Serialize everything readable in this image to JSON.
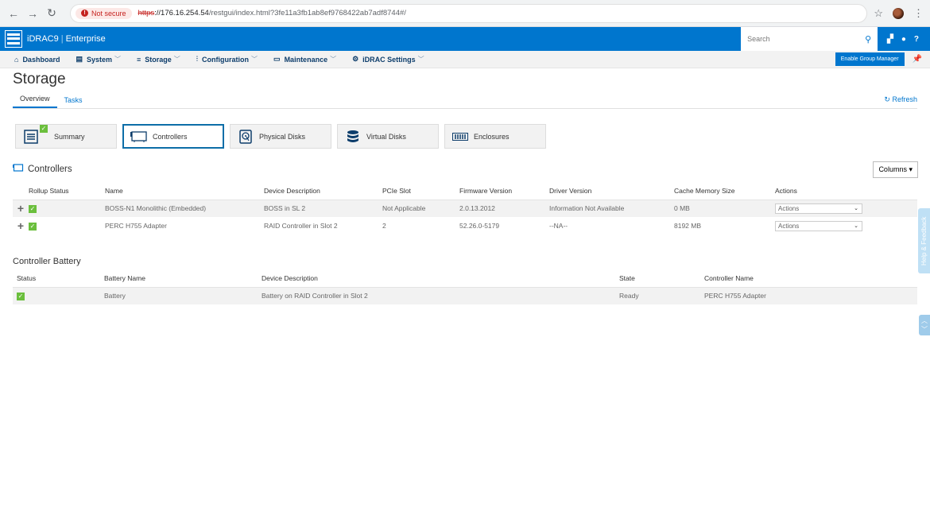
{
  "browser": {
    "security_label": "Not secure",
    "url_scheme": "https",
    "url_host": "://176.16.254.54",
    "url_path": "/restgui/index.html?3fe11a3fb1ab8ef9768422ab7adf8744#/"
  },
  "header": {
    "product": "iDRAC9",
    "edition": "Enterprise",
    "search_placeholder": "Search"
  },
  "nav": {
    "items": [
      {
        "label": "Dashboard",
        "icon": "home-icon",
        "dropdown": false
      },
      {
        "label": "System",
        "icon": "server-icon",
        "dropdown": true
      },
      {
        "label": "Storage",
        "icon": "database-icon",
        "dropdown": true
      },
      {
        "label": "Configuration",
        "icon": "sliders-icon",
        "dropdown": true
      },
      {
        "label": "Maintenance",
        "icon": "monitor-icon",
        "dropdown": true
      },
      {
        "label": "iDRAC Settings",
        "icon": "gears-icon",
        "dropdown": true
      }
    ],
    "group_manager_label": "Enable Group Manager"
  },
  "page": {
    "title": "Storage",
    "tabs": [
      "Overview",
      "Tasks"
    ],
    "refresh_label": "Refresh"
  },
  "tiles": [
    {
      "label": "Summary",
      "active": false
    },
    {
      "label": "Controllers",
      "active": true
    },
    {
      "label": "Physical Disks",
      "active": false
    },
    {
      "label": "Virtual Disks",
      "active": false
    },
    {
      "label": "Enclosures",
      "active": false
    }
  ],
  "controllers": {
    "title": "Controllers",
    "columns_label": "Columns",
    "headers": [
      "Rollup Status",
      "Name",
      "Device Description",
      "PCIe Slot",
      "Firmware Version",
      "Driver Version",
      "Cache Memory Size",
      "Actions"
    ],
    "rows": [
      {
        "name": "BOSS-N1 Monolithic (Embedded)",
        "description": "BOSS in SL 2",
        "slot": "Not Applicable",
        "firmware": "2.0.13.2012",
        "driver": "Information Not Available",
        "cache": "0 MB",
        "action": "Actions"
      },
      {
        "name": "PERC H755 Adapter",
        "description": "RAID Controller in Slot 2",
        "slot": "2",
        "firmware": "52.26.0-5179",
        "driver": "--NA--",
        "cache": "8192 MB",
        "action": "Actions"
      }
    ]
  },
  "battery": {
    "title": "Controller Battery",
    "headers": [
      "Status",
      "Battery Name",
      "Device Description",
      "State",
      "Controller Name"
    ],
    "rows": [
      {
        "name": "Battery",
        "description": "Battery on RAID Controller in Slot 2",
        "state": "Ready",
        "controller": "PERC H755 Adapter"
      }
    ]
  },
  "side": {
    "help_label": "Help & Feedback"
  }
}
